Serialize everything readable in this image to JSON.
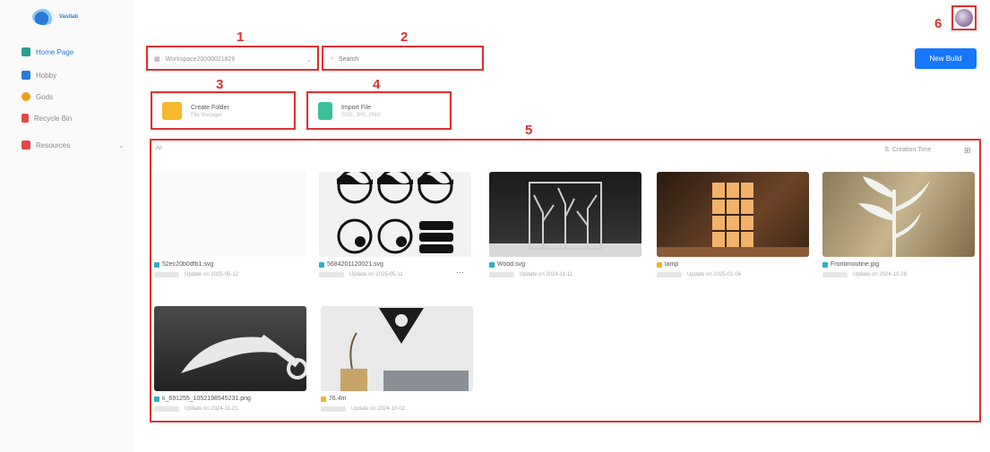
{
  "sidebar": {
    "brand": "Vastlab",
    "items": [
      {
        "label": "Home Page",
        "icon": "home-icon",
        "color": "#2a9d8f"
      },
      {
        "label": "Hobby",
        "icon": "folder-icon",
        "color": "#2a7bd6"
      },
      {
        "label": "Gods",
        "icon": "gift-icon",
        "color": "#f0a020"
      },
      {
        "label": "Recycle Bin",
        "icon": "trash-icon",
        "color": "#e04848"
      },
      {
        "label": "Resources",
        "icon": "book-icon",
        "color": "#e04848"
      }
    ]
  },
  "toolbar": {
    "workspace_value": "Workspace20000021826",
    "search_placeholder": "Search",
    "new_build_label": "New Build"
  },
  "actions": {
    "create_folder": {
      "title": "Create Folder",
      "subtitle": "File Manager"
    },
    "import_file": {
      "title": "Import File",
      "subtitle": "SVG, JPG, PNG"
    }
  },
  "annotations": [
    "1",
    "2",
    "3",
    "4",
    "5",
    "6"
  ],
  "files": {
    "all_label": "All",
    "sort_label": "Creation Time",
    "items": [
      {
        "name": "52ec20b0dfb1.svg",
        "date": "Update on 2025-05-12",
        "type": "svg",
        "color": "#2ab0c4"
      },
      {
        "name": "5684201120021.svg",
        "date": "Update on 2025-05-11",
        "type": "svg",
        "color": "#2ab0c4"
      },
      {
        "name": "Wood.svg",
        "date": "Update on 2024-11-11",
        "type": "svg",
        "color": "#2ab0c4"
      },
      {
        "name": "lamp",
        "date": "Update on 2025-01-06",
        "type": "folder",
        "color": "#f0b429"
      },
      {
        "name": "Frontimoutine.jpg",
        "date": "Update on 2024-10-28",
        "type": "jpg",
        "color": "#2ab0c4"
      },
      {
        "name": "k_691255_1052198545231.png",
        "date": "Update on 2024-11-21",
        "type": "png",
        "color": "#2ab0c4"
      },
      {
        "name": "76.4m",
        "date": "Update on 2024-10-02",
        "type": "folder",
        "color": "#f0b429"
      }
    ]
  },
  "colors": {
    "accent": "#1677ff",
    "annotation": "#e03030"
  }
}
